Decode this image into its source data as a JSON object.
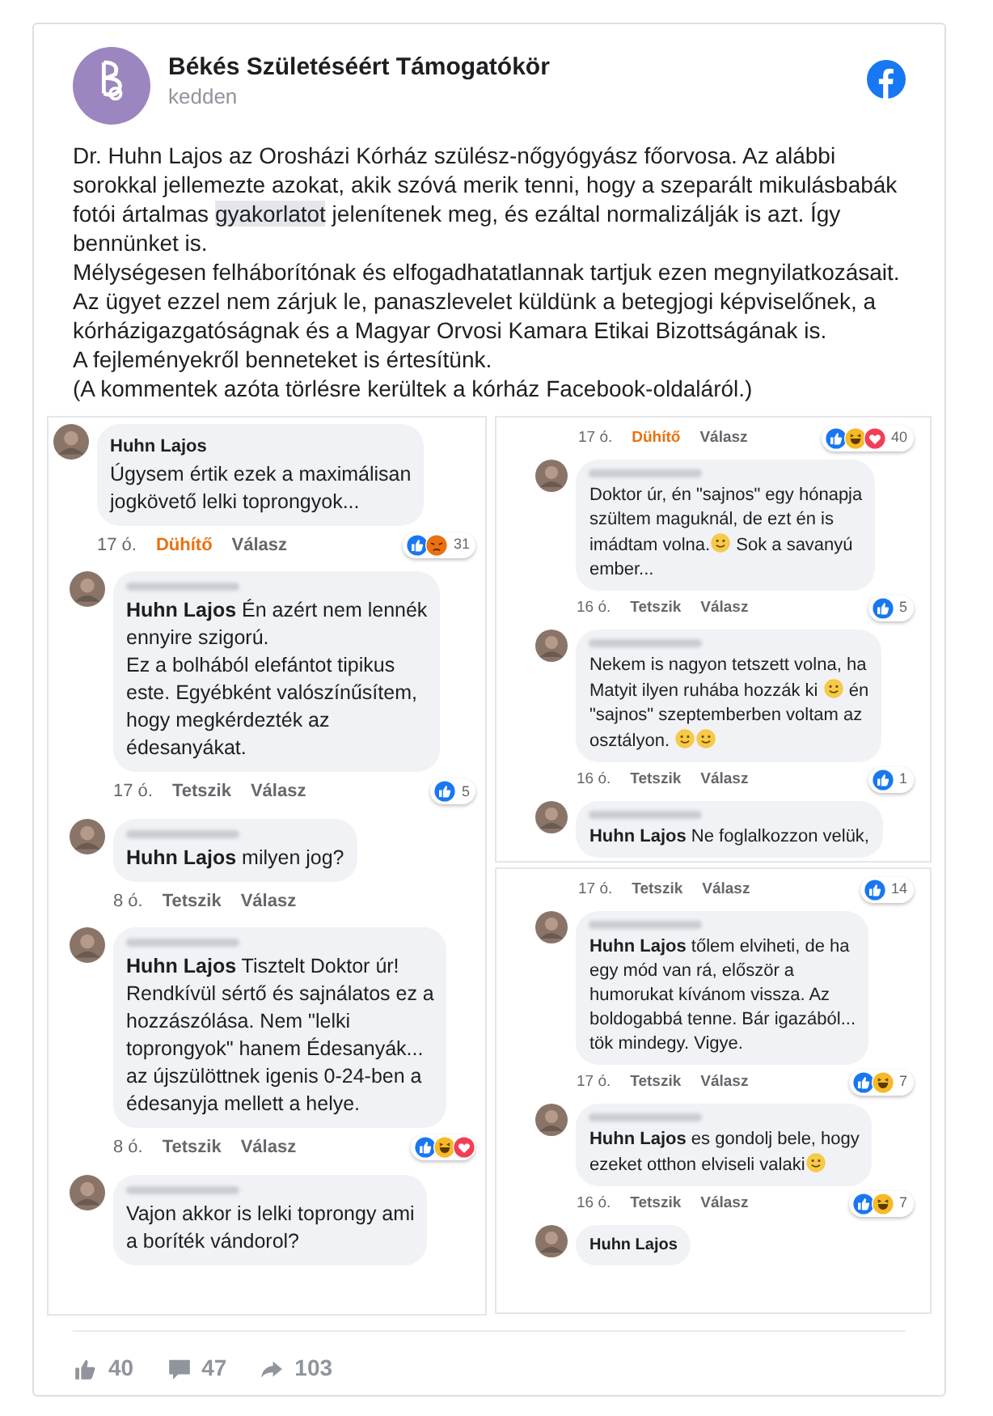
{
  "post": {
    "page_name": "Békés Születéséért Támogatókör",
    "time": "kedden",
    "paragraphs": [
      [
        {
          "text": "Dr. Huhn Lajos az Orosházi Kórház szülész-nőgyógyász főorvosa. Az alábbi sorokkal jellemezte azokat, akik szóvá merik tenni, hogy a szeparált mikulásbabák fotói ártalmas ",
          "highlighted": false
        },
        {
          "text": "gyakorlatot",
          "highlighted": true
        },
        {
          "text": " jelenítenek meg, és ezáltal normalizálják is azt. Így bennünket is.",
          "highlighted": false
        }
      ],
      [
        {
          "text": "Mélységesen felháborítónak és elfogadhatatlannak tartjuk ezen megnyilatkozásait.",
          "highlighted": false
        }
      ],
      [
        {
          "text": "Az ügyet ezzel nem zárjuk le, panaszlevelet küldünk a betegjogi képviselőnek, a kórházigazgatóságnak és a Magyar Orvosi Kamara Etikai Bizottságának is.",
          "highlighted": false
        }
      ],
      [
        {
          "text": "A fejleményekről benneteket is értesítünk.",
          "highlighted": false
        }
      ],
      [
        {
          "text": "(A kommentek azóta törlésre kerültek a kórház Facebook-oldaláról.)",
          "highlighted": false
        }
      ]
    ]
  },
  "collage": [
    {
      "items": [
        {
          "kind": "comment",
          "reply": false,
          "author": "Huhn Lajos",
          "segments": [
            "Úgysem értik ezek a maximálisan\njogkövető lelki toprongyok..."
          ],
          "meta": {
            "time": "17 ó.",
            "action": {
              "label": "Dühítő",
              "reacted": true
            },
            "answer": "Válasz",
            "reactions": [
              {
                "kind": "like"
              },
              {
                "kind": "angry"
              }
            ],
            "count": "31"
          }
        },
        {
          "kind": "comment",
          "reply": true,
          "name_hidden": true,
          "segments": [
            "**Huhn Lajos** Én azért nem lennék\nennyire szigorú.\nEz a bolhából elefántot tipikus\neste. Egyébként valószínűsítem,\nhogy megkérdezték az\nédesanyákat."
          ],
          "meta": {
            "time": "17 ó.",
            "action": {
              "label": "Tetszik",
              "reacted": false
            },
            "answer": "Válasz",
            "reactions": [
              {
                "kind": "like"
              }
            ],
            "count": "5"
          }
        },
        {
          "kind": "comment",
          "reply": true,
          "name_hidden": true,
          "segments": [
            "**Huhn Lajos** milyen jog?"
          ],
          "meta": {
            "time": "8 ó.",
            "action": {
              "label": "Tetszik",
              "reacted": false
            },
            "answer": "Válasz"
          }
        },
        {
          "kind": "comment",
          "reply": true,
          "name_hidden": true,
          "segments": [
            "**Huhn Lajos** Tisztelt Doktor úr!\nRendkívül sértő és sajnálatos ez a\nhozzászólása. Nem \"lelki\ntoprongyok\" hanem Édesanyák...\naz újszülöttnek igenis 0-24-ben a\nédesanyja mellett a helye."
          ],
          "meta": {
            "time": "8 ó.",
            "action": {
              "label": "Tetszik",
              "reacted": false
            },
            "answer": "Válasz",
            "reactions": [
              {
                "kind": "like"
              },
              {
                "kind": "haha"
              },
              {
                "kind": "love"
              }
            ]
          }
        },
        {
          "kind": "comment",
          "reply": true,
          "name_hidden": true,
          "segments": [
            "Vajon akkor is lelki toprongy ami\na boríték vándorol?"
          ]
        }
      ]
    },
    {
      "items": [
        {
          "kind": "meta",
          "meta": {
            "time": "17 ó.",
            "action": {
              "label": "Dühítő",
              "reacted": true
            },
            "answer": "Válasz",
            "reactions": [
              {
                "kind": "like"
              },
              {
                "kind": "haha"
              },
              {
                "kind": "love"
              }
            ],
            "count": "40"
          }
        },
        {
          "kind": "comment",
          "reply": true,
          "name_hidden": true,
          "segments": [
            "Doktor úr, én \"sajnos\" egy hónapja\nszültem maguknál, de ezt én is\nimádtam volna.",
            {
              "kind": "emoji"
            },
            " Sok a savanyú\nember..."
          ],
          "meta": {
            "time": "16 ó.",
            "action": {
              "label": "Tetszik",
              "reacted": false
            },
            "answer": "Válasz",
            "reactions": [
              {
                "kind": "like"
              }
            ],
            "count": "5"
          }
        },
        {
          "kind": "comment",
          "reply": true,
          "name_hidden": true,
          "segments": [
            "Nekem is nagyon tetszett volna, ha\nMatyit ilyen ruhába hozzák ki ",
            {
              "kind": "emoji"
            },
            " én\n\"sajnos\" szeptemberben voltam az\nosztályon. ",
            {
              "kind": "emoji"
            },
            {
              "kind": "emoji"
            }
          ],
          "meta": {
            "time": "16 ó.",
            "action": {
              "label": "Tetszik",
              "reacted": false
            },
            "answer": "Válasz",
            "reactions": [
              {
                "kind": "like"
              }
            ],
            "count": "1"
          }
        },
        {
          "kind": "comment",
          "reply": true,
          "name_hidden": true,
          "segments": [
            "**Huhn Lajos** Ne foglalkozzon velük,"
          ]
        }
      ]
    },
    {
      "items": [
        {
          "kind": "meta",
          "meta": {
            "time": "17 ó.",
            "action": {
              "label": "Tetszik",
              "reacted": false
            },
            "answer": "Válasz",
            "reactions": [
              {
                "kind": "like"
              }
            ],
            "count": "14"
          }
        },
        {
          "kind": "comment",
          "reply": true,
          "name_hidden": true,
          "segments": [
            "**Huhn Lajos** tőlem elviheti, de ha\negy mód van rá, először a\nhumorukat kívánom vissza. Az\nboldogabbá tenne. Bár igazából...\ntök mindegy. Vigye."
          ],
          "meta": {
            "time": "17 ó.",
            "action": {
              "label": "Tetszik",
              "reacted": false
            },
            "answer": "Válasz",
            "reactions": [
              {
                "kind": "like"
              },
              {
                "kind": "haha"
              }
            ],
            "count": "7"
          }
        },
        {
          "kind": "comment",
          "reply": true,
          "name_hidden": true,
          "segments": [
            "**Huhn Lajos** es gondolj bele, hogy\nezeket otthon elviseli valaki",
            {
              "kind": "emoji"
            }
          ],
          "meta": {
            "time": "16 ó.",
            "action": {
              "label": "Tetszik",
              "reacted": false
            },
            "answer": "Válasz",
            "reactions": [
              {
                "kind": "like"
              },
              {
                "kind": "haha"
              }
            ],
            "count": "7"
          }
        },
        {
          "kind": "comment",
          "reply": true,
          "author": "Huhn Lajos"
        }
      ]
    }
  ],
  "footer": {
    "likes": "40",
    "comments": "47",
    "shares": "103"
  }
}
